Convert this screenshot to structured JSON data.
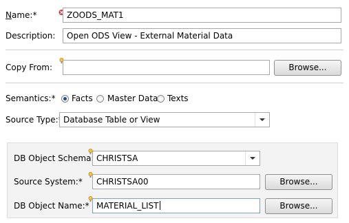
{
  "name": {
    "label": "Name:*",
    "value": "ZOODS_MAT1"
  },
  "description": {
    "label": "Description:",
    "value": "Open ODS View - External Material Data"
  },
  "copy_from": {
    "label": "Copy From:",
    "value": "",
    "browse_label": "Browse..."
  },
  "semantics": {
    "label": "Semantics:*",
    "options": [
      {
        "label": "Facts",
        "checked": true
      },
      {
        "label": "Master Data",
        "checked": false
      },
      {
        "label": "Texts",
        "checked": false
      }
    ]
  },
  "source_type": {
    "label": "Source Type:*",
    "value": "Database Table or View"
  },
  "db_object_schema": {
    "label": "DB Object Schema:*",
    "value": "CHRISTSA"
  },
  "source_system": {
    "label": "Source System:*",
    "value": "CHRISTSA00",
    "browse_label": "Browse..."
  },
  "db_object_name": {
    "label": "DB Object Name:*",
    "value": "MATERIAL_LIST",
    "browse_label": "Browse..."
  },
  "icons": {
    "error": "error-decorator-icon",
    "hint": "content-assist-lightbulb-icon"
  },
  "colors": {
    "accent": "#1f4f8e",
    "group_bg": "#f3f3f3"
  }
}
